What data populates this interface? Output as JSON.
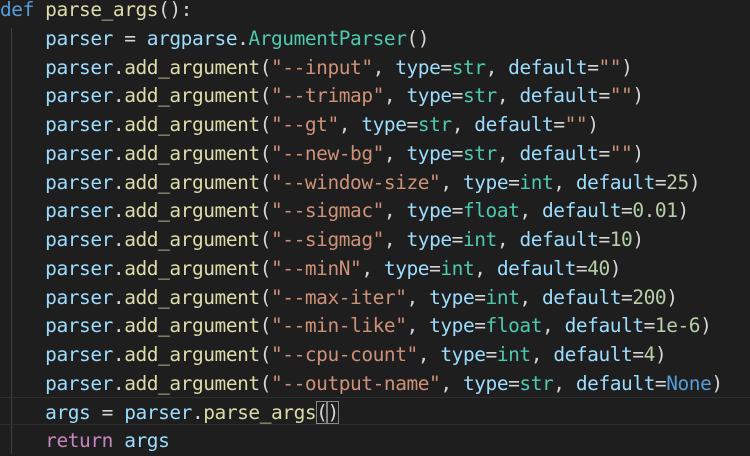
{
  "code": {
    "def_line": {
      "keyword": "def",
      "function_name": "parse_args",
      "signature_tail": "():"
    },
    "parser_line": {
      "var": "parser",
      "assign": " = ",
      "module": "argparse",
      "dot": ".",
      "class_name": "ArgumentParser",
      "parens": "()"
    },
    "args": [
      {
        "flag": "\"--input\"",
        "type": "str",
        "default": "\"\"",
        "default_kind": "str"
      },
      {
        "flag": "\"--trimap\"",
        "type": "str",
        "default": "\"\"",
        "default_kind": "str"
      },
      {
        "flag": "\"--gt\"",
        "type": "str",
        "default": "\"\"",
        "default_kind": "str"
      },
      {
        "flag": "\"--new-bg\"",
        "type": "str",
        "default": "\"\"",
        "default_kind": "str"
      },
      {
        "flag": "\"--window-size\"",
        "type": "int",
        "default": "25",
        "default_kind": "num"
      },
      {
        "flag": "\"--sigmac\"",
        "type": "float",
        "default": "0.01",
        "default_kind": "num"
      },
      {
        "flag": "\"--sigmag\"",
        "type": "int",
        "default": "10",
        "default_kind": "num"
      },
      {
        "flag": "\"--minN\"",
        "type": "int",
        "default": "40",
        "default_kind": "num"
      },
      {
        "flag": "\"--max-iter\"",
        "type": "int",
        "default": "200",
        "default_kind": "num"
      },
      {
        "flag": "\"--min-like\"",
        "type": "float",
        "default": "1e-6",
        "default_kind": "num"
      },
      {
        "flag": "\"--cpu-count\"",
        "type": "int",
        "default": "4",
        "default_kind": "num"
      },
      {
        "flag": "\"--output-name\"",
        "type": "str",
        "default": "None",
        "default_kind": "kw"
      }
    ],
    "arg_tokens": {
      "receiver": "parser",
      "dot": ".",
      "method": "add_argument",
      "open": "(",
      "sep_type": ", ",
      "type_kw": "type",
      "eq": "=",
      "sep_default": ", ",
      "default_kw": "default",
      "close": ")"
    },
    "args_line": {
      "var": "args",
      "assign": " = ",
      "receiver": "parser",
      "dot": ".",
      "method": "parse_args",
      "open": "(",
      "close": ")"
    },
    "return_line": {
      "keyword": "return",
      "space": " ",
      "var": "args"
    }
  },
  "colors": {
    "background": "#1e1e1e",
    "keyword": "#569cd6",
    "control_keyword": "#c586c0",
    "function": "#dcdcaa",
    "variable": "#9cdcfe",
    "class": "#4ec9b0",
    "string": "#ce9178",
    "number": "#b5cea8",
    "punctuation": "#d4d4d4"
  }
}
